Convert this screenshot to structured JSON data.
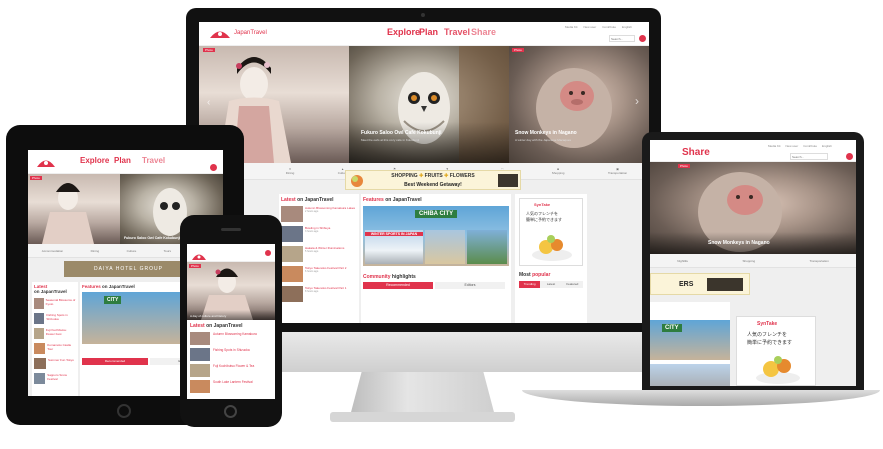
{
  "brand": {
    "logo_text": "JapanTravel",
    "accent": "#e0334c"
  },
  "nav": {
    "explore": "Explore",
    "plan": "Plan",
    "travel": "Travel",
    "share": "Share"
  },
  "search": {
    "placeholder": "Search..."
  },
  "topbar": {
    "links": [
      "Media Kit",
      "New user",
      "Contribute",
      "English"
    ]
  },
  "hero": {
    "tag": "Photo",
    "slide_owl_title": "Fukuro Saloo Owl Cafe Kokubunji",
    "slide_owl_sub": "Meet the owls at this cozy cafe in Kokubunji",
    "slide_monkey_title": "Snow Monkeys in Nagano",
    "slide_monkey_sub": "A winter day with the Japanese Macaques"
  },
  "categories": [
    "Accommodation",
    "Dining",
    "Culture",
    "Tours",
    "Nightlife",
    "Wellness",
    "Shopping",
    "Transportation"
  ],
  "banner": {
    "line1_a": "SHOPPING",
    "line1_b": "FRUITS",
    "line1_c": "FLOWERS",
    "line2": "Best Weekend Getaway!",
    "laptop_text": "ERS"
  },
  "latest": {
    "heading_a": "Latest",
    "heading_b": "on JapanTravel",
    "items": [
      {
        "title": "Autumn Blossoming Kamakura Lakes",
        "date": "2 hours ago"
      },
      {
        "title": "Bowling in Shibuya",
        "date": "3 hours ago"
      },
      {
        "title": "Hakata & Winter Illuminations",
        "date": "5 hours ago"
      },
      {
        "title": "Tokyo Takenoko Festival Part 2",
        "date": "6 hours ago"
      },
      {
        "title": "Tokyo Takenoko Festival Part 1",
        "date": "8 hours ago"
      }
    ]
  },
  "features": {
    "heading_a": "Features",
    "heading_b": "on JapanTravel",
    "sign_text": "CHIBA CITY",
    "winter_text": "WINTER SPORTS IN JAPAN",
    "tab_city_text": "CITY"
  },
  "ad": {
    "brand": "SynTake",
    "text_l1": "人気のフレンチを",
    "text_l2": "簡単に予約できます"
  },
  "community": {
    "heading_a": "Community",
    "heading_b": "highlights",
    "tab_recommended": "Recommended",
    "tab_editors": "Editors"
  },
  "popular": {
    "heading_a": "Most",
    "heading_b": "popular",
    "tabs": [
      "Trending",
      "Latest",
      "Featured"
    ]
  },
  "tablet": {
    "latest_heading_a": "Latest",
    "latest_heading_b": "on JapanTravel",
    "features_heading_a": "Features",
    "features_heading_b": "on JapanTravel",
    "items": [
      "Seasonal Blossoms of Kyoto",
      "Fishing Spots in Shizuoka",
      "Fuji Kuchibutsu Flower Fest",
      "Kumamoto Castle Tour",
      "Summer Fun Tokyo",
      "Sapporo Snow Festival"
    ],
    "banner_text": "DAIYA HOTEL GROUP",
    "tab_recommended": "Recommended",
    "tab_editors": "Editors"
  },
  "phone": {
    "caption": "A day of culture and history",
    "latest_heading_a": "Latest",
    "latest_heading_b": "on JapanTravel",
    "items": [
      "Autumn Blossoming Kamakura",
      "Fishing Spots in Shizuoka",
      "Fuji Kuchibutsu Flower & Tea",
      "South Lake Lantern Festival"
    ]
  }
}
